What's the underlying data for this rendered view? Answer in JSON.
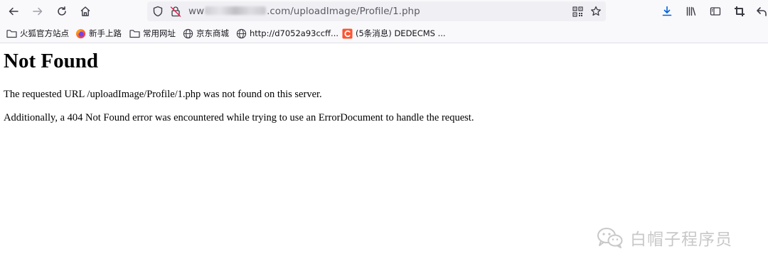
{
  "browser": {
    "url": {
      "prefix": "ww",
      "suffix": ".com/uploadImage/Profile/1.php"
    },
    "icons": {
      "back": "arrow-left-icon",
      "forward": "arrow-right-icon",
      "reload": "reload-icon",
      "home": "home-icon",
      "tracking": "shield-icon",
      "insecure": "insecure-lock-icon",
      "qr": "qr-code-icon",
      "bookmark_star": "star-icon",
      "downloads": "download-icon",
      "library": "library-icon",
      "sidebar": "sidebar-icon",
      "screenshot": "crop-icon",
      "more": "undo-arrow-icon"
    },
    "bookmarks": [
      {
        "label": "火狐官方站点",
        "icon": "folder-icon"
      },
      {
        "label": "新手上路",
        "icon": "firefox-icon"
      },
      {
        "label": "常用网址",
        "icon": "folder-icon"
      },
      {
        "label": "京东商城",
        "icon": "globe-icon"
      },
      {
        "label": "http://d7052a93ccff...",
        "icon": "globe-icon"
      },
      {
        "label": "(5条消息) DEDECMS ...",
        "icon": "csdn-icon"
      }
    ]
  },
  "page": {
    "title": "Not Found",
    "line1": "The requested URL /uploadImage/Profile/1.php was not found on this server.",
    "line2": "Additionally, a 404 Not Found error was encountered while trying to use an ErrorDocument to handle the request."
  },
  "watermark": {
    "text": "白帽子程序员",
    "icon": "wechat-icon"
  },
  "colors": {
    "chrome_bg": "#f9f9fb",
    "urlbar_bg": "#f0f0f4",
    "download_blue": "#0060df",
    "csdn_red": "#fc5531",
    "watermark_gray": "#c8c8c8"
  }
}
